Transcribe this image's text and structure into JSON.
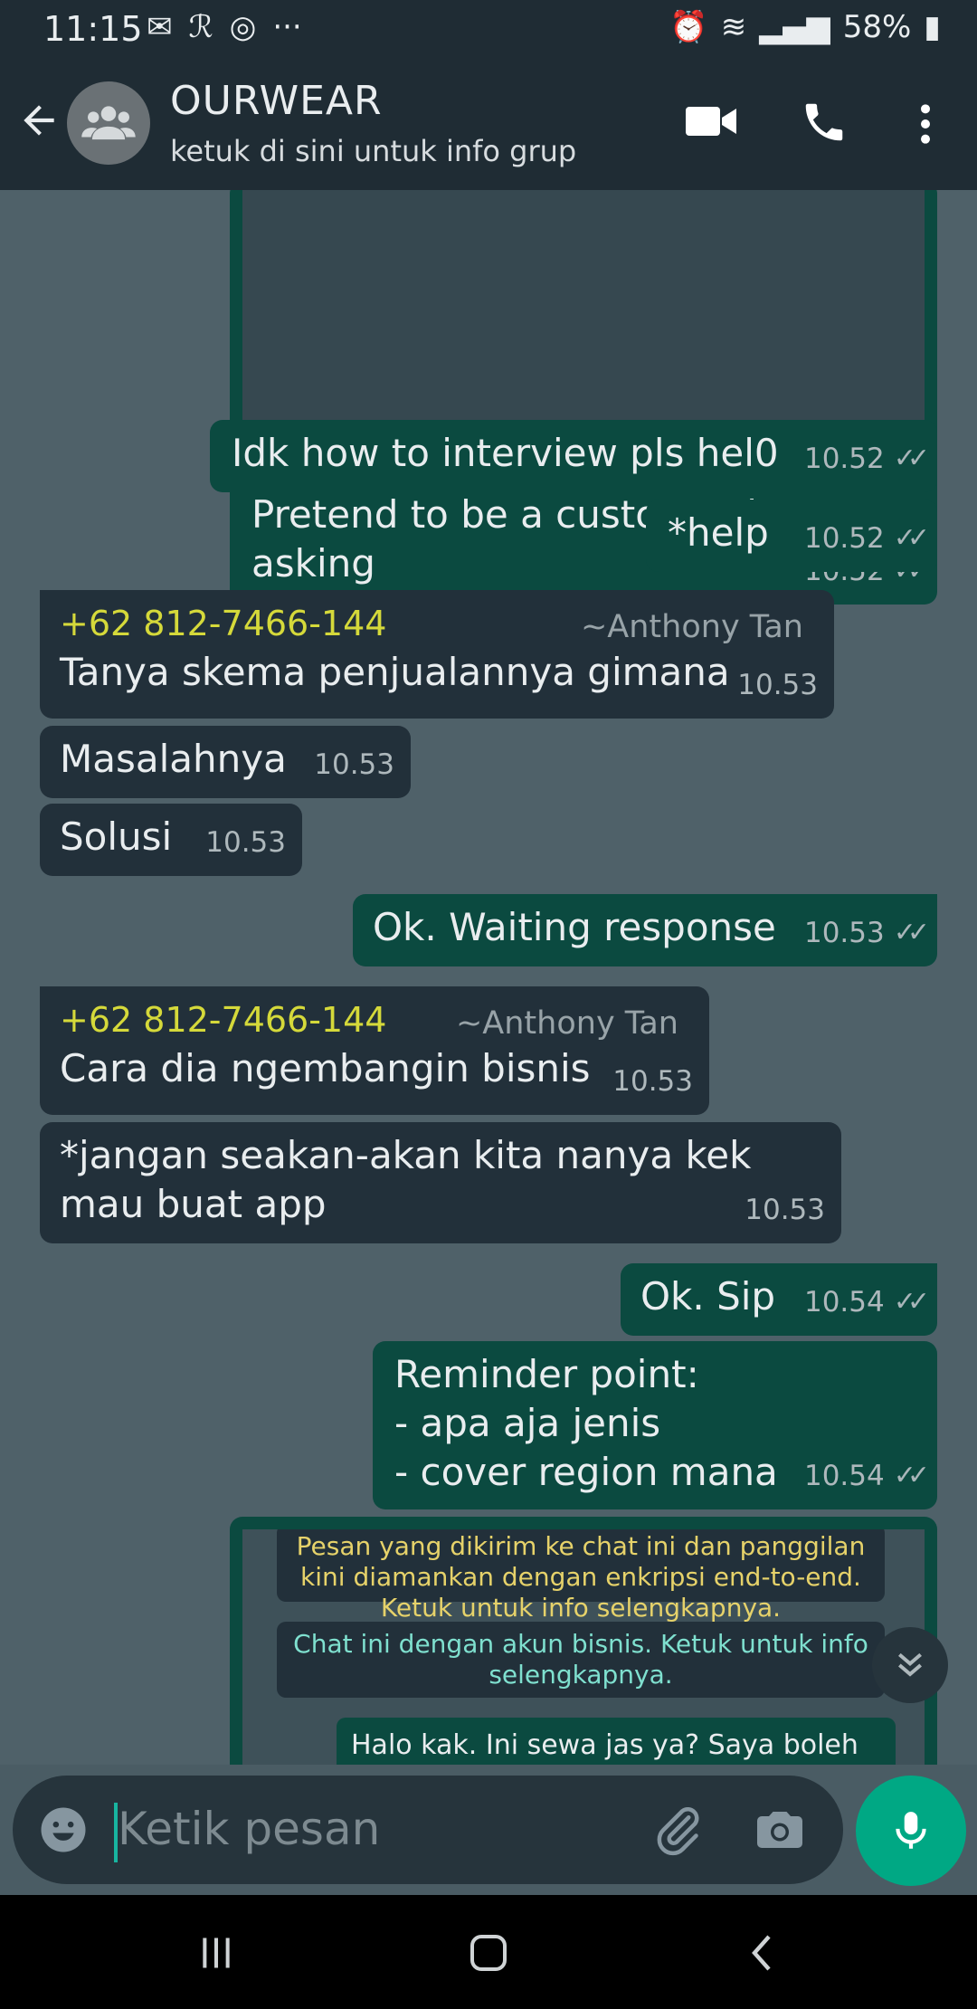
{
  "status": {
    "time": "11:15",
    "battery": "58%"
  },
  "header": {
    "title": "OURWEAR",
    "subtitle": "ketuk di sini untuk info grup"
  },
  "messages": [
    {
      "id": "m1",
      "text": "Pretend to be a customer just asking",
      "time": "10.52"
    },
    {
      "id": "m2",
      "text": "Idk how to interview pls hel0",
      "time": "10.52"
    },
    {
      "id": "m3",
      "text": "*help",
      "time": "10.52"
    },
    {
      "id": "m4",
      "sender": "+62 812-7466-144",
      "author": "~Anthony Tan",
      "text": "Tanya skema penjualannya gimana",
      "time": "10.53"
    },
    {
      "id": "m5",
      "text": "Masalahnya",
      "time": "10.53"
    },
    {
      "id": "m6",
      "text": "Solusi",
      "time": "10.53"
    },
    {
      "id": "m7",
      "text": "Ok. Waiting response",
      "time": "10.53"
    },
    {
      "id": "m8",
      "sender": "+62 812-7466-144",
      "author": "~Anthony Tan",
      "text": "Cara dia ngembangin bisnis",
      "time": "10.53"
    },
    {
      "id": "m9",
      "text": "*jangan seakan-akan kita nanya kek mau buat app",
      "time": "10.53"
    },
    {
      "id": "m10",
      "text": "Ok. Sip",
      "time": "10.54"
    },
    {
      "id": "m11",
      "line1": "Reminder point:",
      "line2": "- apa aja jenis",
      "line3": "- cover region mana",
      "time": "10.54"
    }
  ],
  "preview": {
    "card1": "Pesan yang dikirim ke chat ini dan panggilan kini diamankan dengan enkripsi end-to-end. Ketuk untuk info selengkapnya.",
    "card2": "Chat ini dengan akun bisnis. Ketuk untuk info selengkapnya.",
    "card3": "Halo kak. Ini sewa jas ya? Saya boleh"
  },
  "composer": {
    "placeholder": "Ketik pesan"
  }
}
